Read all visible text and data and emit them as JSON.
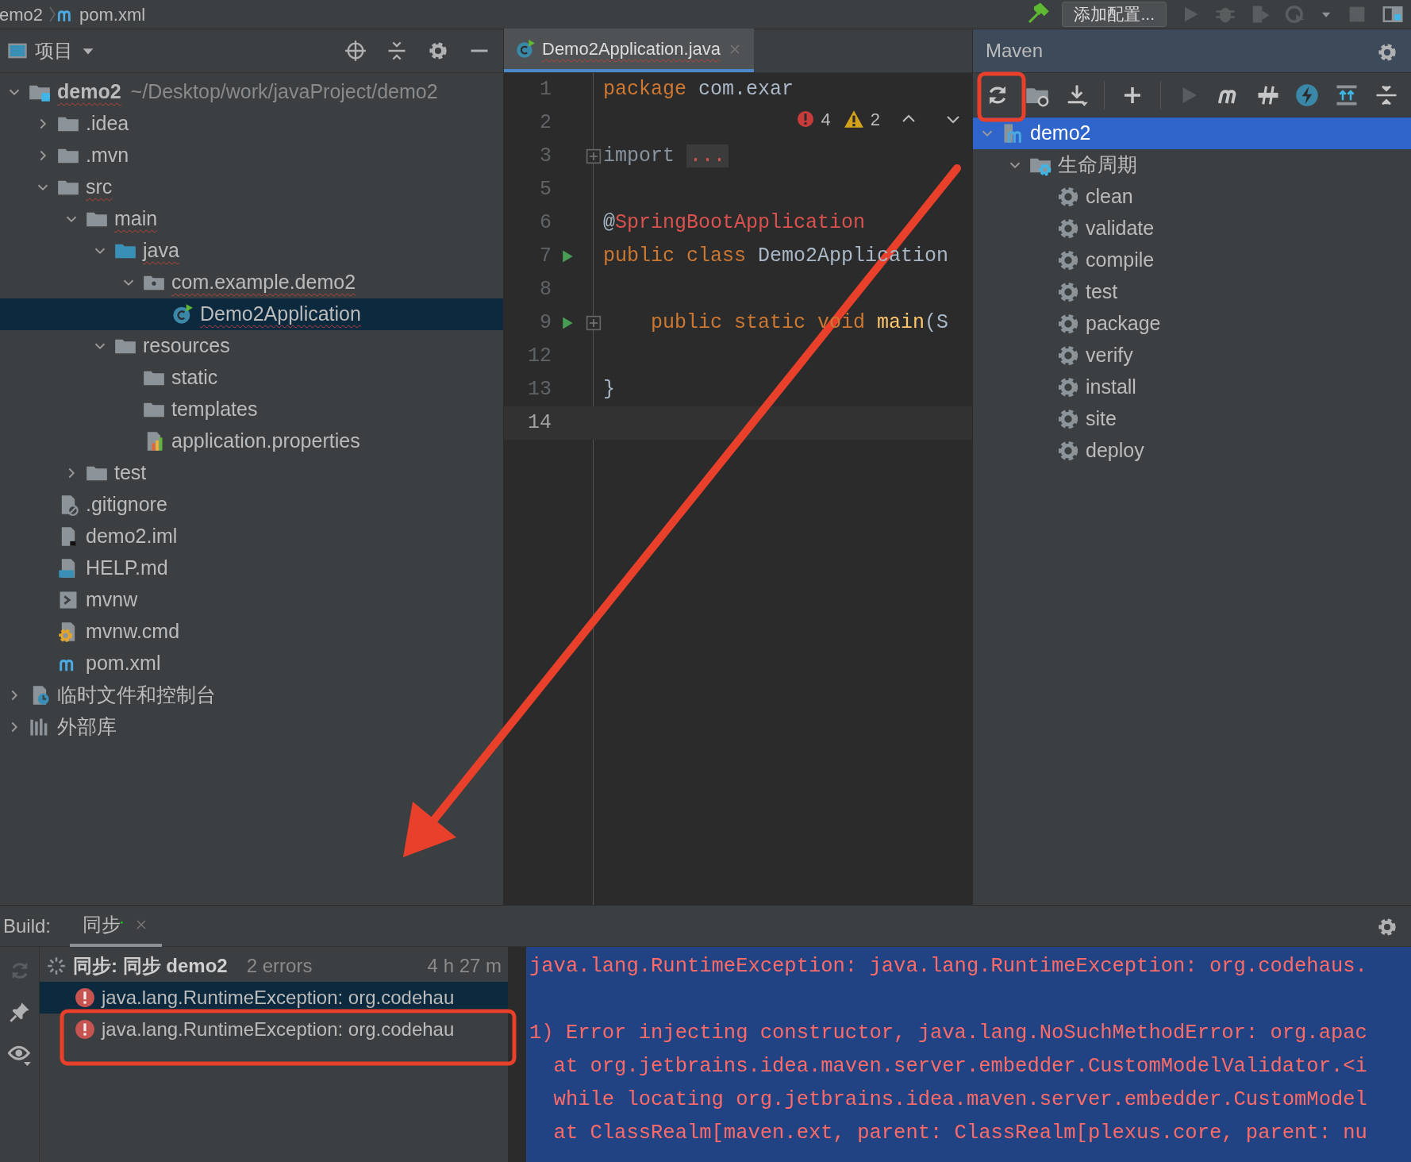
{
  "breadcrumb": [
    {
      "label": "emo2"
    },
    {
      "label": "pom.xml"
    }
  ],
  "run_toolbar": {
    "config_button": "添加配置..."
  },
  "project_panel": {
    "title": "项目",
    "tree": [
      {
        "label": "demo2",
        "path": "~/Desktop/work/javaProject/demo2",
        "kind": "module",
        "errors": true,
        "selected": false,
        "expanded": true,
        "children": [
          {
            "label": ".idea",
            "kind": "folder",
            "errors": false,
            "selected": false,
            "expanded": false
          },
          {
            "label": ".mvn",
            "kind": "folder",
            "errors": false,
            "selected": false,
            "expanded": false
          },
          {
            "label": "src",
            "kind": "folder",
            "errors": true,
            "selected": false,
            "expanded": true,
            "children": [
              {
                "label": "main",
                "kind": "folder",
                "errors": true,
                "selected": false,
                "expanded": true,
                "children": [
                  {
                    "label": "java",
                    "kind": "source-folder",
                    "errors": true,
                    "selected": false,
                    "expanded": true,
                    "children": [
                      {
                        "label": "com.example.demo2",
                        "kind": "package",
                        "errors": true,
                        "selected": false,
                        "expanded": true,
                        "children": [
                          {
                            "label": "Demo2Application",
                            "kind": "spring-class",
                            "errors": true,
                            "selected": true
                          }
                        ]
                      }
                    ]
                  },
                  {
                    "label": "resources",
                    "kind": "folder",
                    "errors": false,
                    "selected": false,
                    "expanded": true,
                    "children": [
                      {
                        "label": "static",
                        "kind": "folder",
                        "errors": false,
                        "selected": false
                      },
                      {
                        "label": "templates",
                        "kind": "folder",
                        "errors": false,
                        "selected": false
                      },
                      {
                        "label": "application.properties",
                        "kind": "properties",
                        "errors": false,
                        "selected": false
                      }
                    ]
                  }
                ]
              },
              {
                "label": "test",
                "kind": "folder",
                "errors": false,
                "selected": false,
                "expanded": false
              }
            ]
          },
          {
            "label": ".gitignore",
            "kind": "ignored",
            "errors": false,
            "selected": false
          },
          {
            "label": "demo2.iml",
            "kind": "iml",
            "errors": false,
            "selected": false
          },
          {
            "label": "HELP.md",
            "kind": "markdown",
            "errors": false,
            "selected": false
          },
          {
            "label": "mvnw",
            "kind": "script",
            "errors": false,
            "selected": false
          },
          {
            "label": "mvnw.cmd",
            "kind": "cmd",
            "errors": false,
            "selected": false
          },
          {
            "label": "pom.xml",
            "kind": "maven",
            "errors": false,
            "selected": false
          }
        ]
      },
      {
        "label": "临时文件和控制台",
        "kind": "scratch",
        "errors": false,
        "selected": false,
        "expanded": false
      },
      {
        "label": "外部库",
        "kind": "library",
        "errors": false,
        "selected": false,
        "expanded": false
      }
    ]
  },
  "editor": {
    "tabs": [
      {
        "label": "Demo2Application.java",
        "selected": true,
        "errors": true
      }
    ],
    "inspections": {
      "errors": "4",
      "warnings": "2"
    },
    "lines": [
      {
        "number": "1",
        "run": false,
        "fold": false,
        "current": false,
        "tokens": [
          {
            "text": "package",
            "kind": "keyword"
          },
          {
            "text": " com.exar",
            "kind": "plain"
          }
        ]
      },
      {
        "number": "2",
        "run": false,
        "fold": false,
        "current": false
      },
      {
        "number": "3",
        "run": false,
        "fold": true,
        "current": false,
        "tokens": [
          {
            "text": "import",
            "kind": "dim"
          },
          {
            "text": "...",
            "kind": "folded"
          }
        ]
      },
      {
        "number": "5",
        "run": false,
        "fold": false,
        "current": false
      },
      {
        "number": "6",
        "run": false,
        "fold": false,
        "current": false,
        "tokens": [
          {
            "text": "@",
            "kind": "plain"
          },
          {
            "text": "SpringBootApplication",
            "kind": "annotation"
          }
        ]
      },
      {
        "number": "7",
        "run": true,
        "fold": false,
        "current": false,
        "tokens": [
          {
            "text": "public class",
            "kind": "keyword"
          },
          {
            "text": " Demo2Application",
            "kind": "plain"
          }
        ]
      },
      {
        "number": "8",
        "run": false,
        "fold": false,
        "current": false
      },
      {
        "number": "9",
        "run": true,
        "fold": true,
        "current": false,
        "tokens": [
          {
            "text": "    public static void",
            "kind": "keyword"
          },
          {
            "text": " main",
            "kind": "method"
          },
          {
            "text": "(S",
            "kind": "plain"
          }
        ]
      },
      {
        "number": "12",
        "run": false,
        "fold": false,
        "current": false
      },
      {
        "number": "13",
        "run": false,
        "fold": false,
        "current": false,
        "tokens": [
          {
            "text": "}",
            "kind": "plain"
          }
        ]
      },
      {
        "number": "14",
        "run": false,
        "fold": false,
        "current": true
      }
    ]
  },
  "maven_panel": {
    "title": "Maven",
    "tree": [
      {
        "label": "demo2",
        "kind": "maven-module",
        "selected": true,
        "expanded": true,
        "children": [
          {
            "label": "生命周期",
            "kind": "lifecycle",
            "selected": false,
            "expanded": true,
            "children": [
              {
                "label": "clean",
                "kind": "goal",
                "selected": false
              },
              {
                "label": "validate",
                "kind": "goal",
                "selected": false
              },
              {
                "label": "compile",
                "kind": "goal",
                "selected": false
              },
              {
                "label": "test",
                "kind": "goal",
                "selected": false
              },
              {
                "label": "package",
                "kind": "goal",
                "selected": false
              },
              {
                "label": "verify",
                "kind": "goal",
                "selected": false
              },
              {
                "label": "install",
                "kind": "goal",
                "selected": false
              },
              {
                "label": "site",
                "kind": "goal",
                "selected": false
              },
              {
                "label": "deploy",
                "kind": "goal",
                "selected": false
              }
            ]
          }
        ]
      }
    ]
  },
  "build_panel": {
    "label": "Build:",
    "tabs": [
      {
        "label": "同步",
        "selected": true
      }
    ],
    "task": {
      "label": "同步: 同步 demo2",
      "summary": "2 errors",
      "time": "4 h 27 m",
      "children": [
        {
          "label": "java.lang.RuntimeException: org.codehau",
          "selected": true
        },
        {
          "label": "java.lang.RuntimeException: org.codehau",
          "selected": false
        }
      ]
    },
    "console": [
      {
        "text": "java.lang.RuntimeException: java.lang.RuntimeException: org.codehaus.",
        "kind": "exception"
      },
      {
        "text": "1) Error injecting constructor, java.lang.NoSuchMethodError: org.apac",
        "kind": "cause"
      },
      {
        "text": "  at org.jetbrains.idea.maven.server.embedder.CustomModelValidator.<i",
        "kind": "trace"
      },
      {
        "text": "  while locating org.jetbrains.idea.maven.server.embedder.CustomModel",
        "kind": "trace"
      },
      {
        "text": "  at ClassRealm[maven.ext, parent: ClassRealm[plexus.core, parent: nu",
        "kind": "trace"
      }
    ]
  }
}
